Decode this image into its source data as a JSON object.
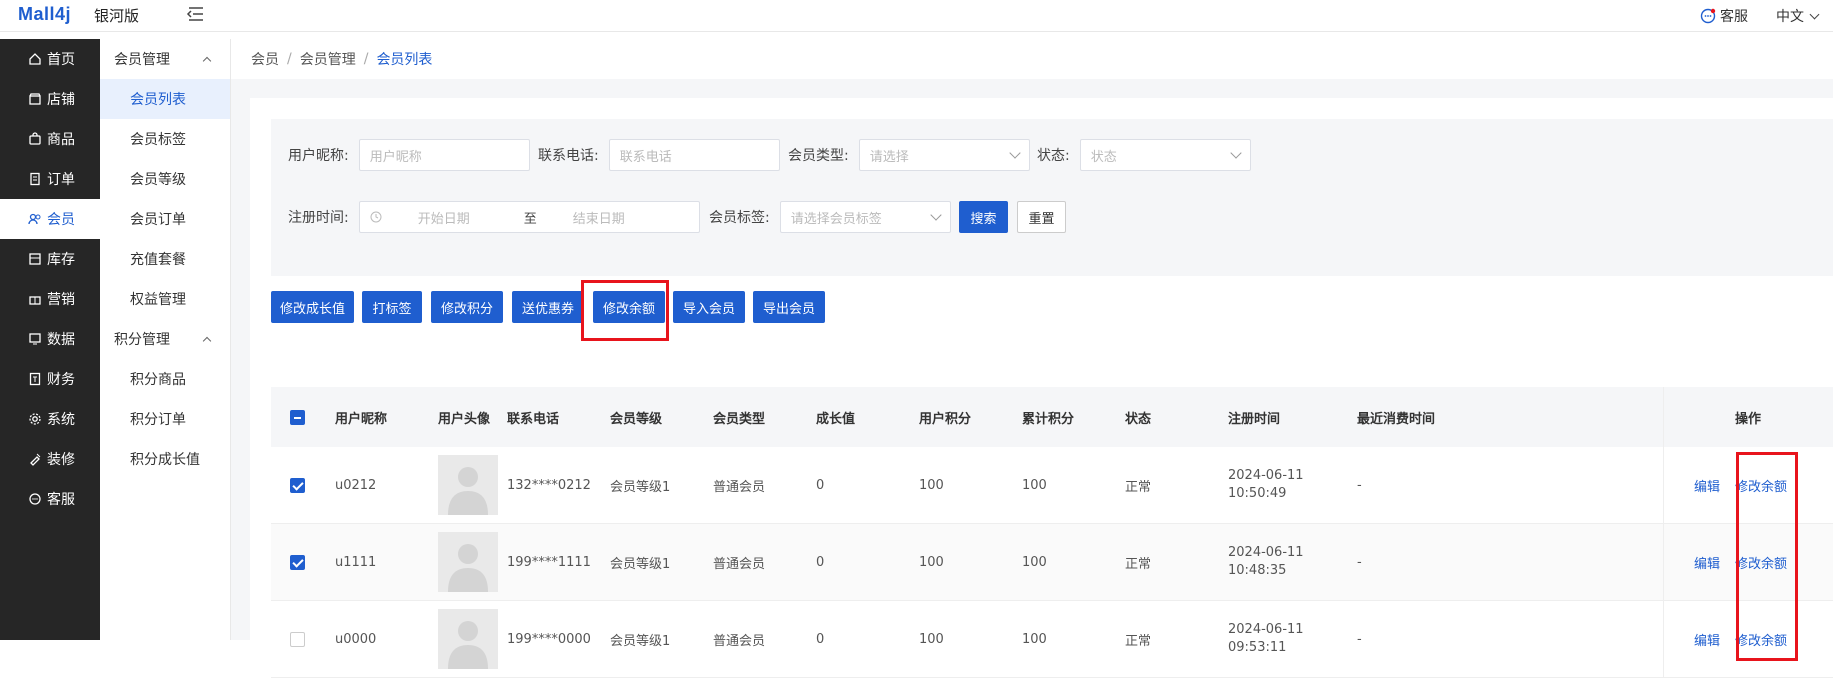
{
  "header": {
    "logo": "Mall4j",
    "edition": "银河版",
    "service": "客服",
    "lang": "中文"
  },
  "main_menu": [
    {
      "label": "首页",
      "icon": "home-icon"
    },
    {
      "label": "店铺",
      "icon": "shop-icon"
    },
    {
      "label": "商品",
      "icon": "bag-icon"
    },
    {
      "label": "订单",
      "icon": "order-icon"
    },
    {
      "label": "会员",
      "icon": "member-icon",
      "active": true
    },
    {
      "label": "库存",
      "icon": "stock-icon"
    },
    {
      "label": "营销",
      "icon": "gift-icon"
    },
    {
      "label": "数据",
      "icon": "data-icon"
    },
    {
      "label": "财务",
      "icon": "finance-icon"
    },
    {
      "label": "系统",
      "icon": "system-icon"
    },
    {
      "label": "装修",
      "icon": "decor-icon"
    },
    {
      "label": "客服",
      "icon": "chat-icon"
    }
  ],
  "sub_menu": {
    "group1": "会员管理",
    "items1": [
      "会员列表",
      "会员标签",
      "会员等级",
      "会员订单",
      "充值套餐",
      "权益管理"
    ],
    "group2": "积分管理",
    "items2": [
      "积分商品",
      "积分订单",
      "积分成长值"
    ]
  },
  "breadcrumb": [
    "会员",
    "会员管理",
    "会员列表"
  ],
  "search": {
    "nickname_label": "用户昵称:",
    "nickname_ph": "用户昵称",
    "phone_label": "联系电话:",
    "phone_ph": "联系电话",
    "type_label": "会员类型:",
    "type_ph": "请选择",
    "status_label": "状态:",
    "status_ph": "状态",
    "regtime_label": "注册时间:",
    "start_ph": "开始日期",
    "to": "至",
    "end_ph": "结束日期",
    "tag_label": "会员标签:",
    "tag_ph": "请选择会员标签",
    "search_btn": "搜索",
    "reset_btn": "重置"
  },
  "actions": [
    "修改成长值",
    "打标签",
    "修改积分",
    "送优惠券",
    "修改余额",
    "导入会员",
    "导出会员"
  ],
  "table": {
    "headers": [
      "用户昵称",
      "用户头像",
      "联系电话",
      "会员等级",
      "会员类型",
      "成长值",
      "用户积分",
      "累计积分",
      "状态",
      "注册时间",
      "最近消费时间",
      "操作"
    ],
    "rows": [
      {
        "checked": true,
        "nick": "u0212",
        "phone": "132****0212",
        "level": "会员等级1",
        "type": "普通会员",
        "growth": "0",
        "points": "100",
        "total": "100",
        "status": "正常",
        "date": "2024-06-11",
        "time": "10:50:49",
        "last": "-",
        "edit": "编辑",
        "balance": "修改余额"
      },
      {
        "checked": true,
        "nick": "u1111",
        "phone": "199****1111",
        "level": "会员等级1",
        "type": "普通会员",
        "growth": "0",
        "points": "100",
        "total": "100",
        "status": "正常",
        "date": "2024-06-11",
        "time": "10:48:35",
        "last": "-",
        "edit": "编辑",
        "balance": "修改余额"
      },
      {
        "checked": false,
        "nick": "u0000",
        "phone": "199****0000",
        "level": "会员等级1",
        "type": "普通会员",
        "growth": "0",
        "points": "100",
        "total": "100",
        "status": "正常",
        "date": "2024-06-11",
        "time": "09:53:11",
        "last": "-",
        "edit": "编辑",
        "balance": "修改余额"
      }
    ]
  },
  "colors": {
    "primary": "#1f5ecf",
    "highlight": "#e8141c",
    "sidebar": "#262626"
  }
}
